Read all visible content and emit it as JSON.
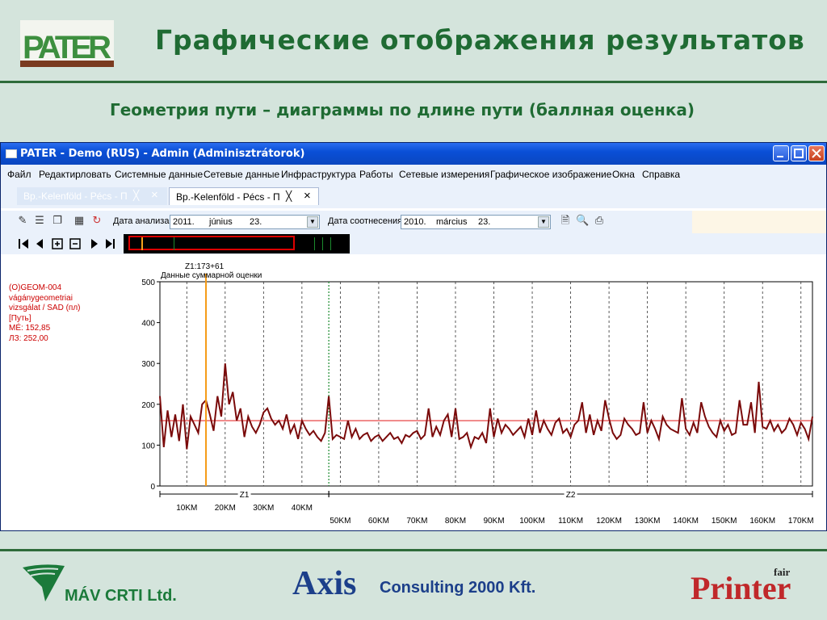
{
  "slide": {
    "logo_text": "PATER",
    "title": "Графические отображения результатов",
    "subtitle": "Геометрия пути – диаграммы по длине пути (баллная оценка)"
  },
  "window": {
    "title": "PATER - Demo (RUS) - Admin (Adminisztrátorok)",
    "menu": [
      "Файл",
      "Редактирловать",
      "Системные данные",
      "Сетевые данные",
      "Инфраструктура",
      "Работы",
      "Сетевые измерения",
      "Графическое изображение",
      "Окна",
      "Справка"
    ],
    "tabs": [
      {
        "label": "Bp.-Kelenföld - Pécs - П",
        "active": false
      },
      {
        "label": "Bp.-Kelenföld - Pécs - П",
        "active": true
      }
    ],
    "toolbar": {
      "analysis_date_label": "Дата анализа",
      "analysis_date": {
        "year": "2011.",
        "month": "június",
        "day": "23."
      },
      "compare_date_label": "Дата соотнесения",
      "compare_date": {
        "year": "2010.",
        "month": "március",
        "day": "23."
      }
    }
  },
  "legend": {
    "lines": [
      "(O)GEOM-004",
      "vágánygeometriai",
      "vizsgálat / SAD (пл)",
      "[Путь]",
      "MÉ: 152,85",
      "ЛЗ: 252,00"
    ]
  },
  "chart_data": {
    "type": "line",
    "title": "Данные суммарной оценки",
    "cursor_label": "Z1:173+61",
    "ylim": [
      0,
      500
    ],
    "yticks": [
      0,
      100,
      200,
      300,
      400,
      500
    ],
    "xlim": [
      3,
      173
    ],
    "x_ticks": [
      {
        "km": 10,
        "label": "10KM"
      },
      {
        "km": 20,
        "label": "20KM"
      },
      {
        "km": 30,
        "label": "30KM"
      },
      {
        "km": 40,
        "label": "40KM"
      },
      {
        "km": 50,
        "label": "50KM"
      },
      {
        "km": 60,
        "label": "60KM"
      },
      {
        "km": 70,
        "label": "70KM"
      },
      {
        "km": 80,
        "label": "80KM"
      },
      {
        "km": 90,
        "label": "90KM"
      },
      {
        "km": 100,
        "label": "100KM"
      },
      {
        "km": 110,
        "label": "110KM"
      },
      {
        "km": 120,
        "label": "120KM"
      },
      {
        "km": 130,
        "label": "130KM"
      },
      {
        "km": 140,
        "label": "140KM"
      },
      {
        "km": 150,
        "label": "150KM"
      },
      {
        "km": 160,
        "label": "160KM"
      },
      {
        "km": 170,
        "label": "170KM"
      }
    ],
    "zones": [
      {
        "label": "Z1",
        "from": 3,
        "to": 47
      },
      {
        "label": "Z2",
        "from": 47,
        "to": 173
      }
    ],
    "cursor_km": 15,
    "reference_value": 160,
    "series": [
      {
        "x": [
          3,
          4,
          5,
          6,
          7,
          8,
          9,
          10,
          11,
          12,
          13,
          14,
          15,
          16,
          17,
          18,
          19,
          20,
          21,
          22,
          23,
          24,
          25,
          26,
          27,
          28,
          29,
          30,
          31,
          32,
          33,
          34,
          35,
          36,
          37,
          38,
          39,
          40,
          41,
          42,
          43,
          44,
          45,
          46,
          47,
          48,
          49,
          50,
          51,
          52,
          53,
          54,
          55,
          56,
          57,
          58,
          59,
          60,
          61,
          62,
          63,
          64,
          65,
          66,
          67,
          68,
          69,
          70,
          71,
          72,
          73,
          74,
          75,
          76,
          77,
          78,
          79,
          80,
          81,
          82,
          83,
          84,
          85,
          86,
          87,
          88,
          89,
          90,
          91,
          92,
          93,
          94,
          95,
          96,
          97,
          98,
          99,
          100,
          101,
          102,
          103,
          104,
          105,
          106,
          107,
          108,
          109,
          110,
          111,
          112,
          113,
          114,
          115,
          116,
          117,
          118,
          119,
          120,
          121,
          122,
          123,
          124,
          125,
          126,
          127,
          128,
          129,
          130,
          131,
          132,
          133,
          134,
          135,
          136,
          137,
          138,
          139,
          140,
          141,
          142,
          143,
          144,
          145,
          146,
          147,
          148,
          149,
          150,
          151,
          152,
          153,
          154,
          155,
          156,
          157,
          158,
          159,
          160,
          161,
          162,
          163,
          164,
          165,
          166,
          167,
          168,
          169,
          170,
          171,
          172,
          173
        ],
        "values": [
          220,
          95,
          185,
          120,
          175,
          110,
          200,
          90,
          170,
          150,
          130,
          200,
          210,
          175,
          135,
          220,
          170,
          300,
          200,
          230,
          160,
          190,
          120,
          170,
          145,
          130,
          150,
          180,
          190,
          165,
          150,
          160,
          140,
          175,
          130,
          150,
          115,
          160,
          140,
          125,
          135,
          120,
          110,
          130,
          220,
          115,
          125,
          120,
          115,
          160,
          120,
          140,
          115,
          125,
          130,
          110,
          120,
          125,
          110,
          120,
          130,
          115,
          120,
          105,
          125,
          120,
          130,
          135,
          115,
          125,
          190,
          120,
          145,
          125,
          160,
          175,
          120,
          190,
          115,
          120,
          130,
          95,
          120,
          115,
          130,
          105,
          190,
          120,
          165,
          130,
          150,
          140,
          125,
          135,
          145,
          120,
          165,
          125,
          185,
          130,
          160,
          140,
          125,
          155,
          165,
          130,
          140,
          120,
          150,
          160,
          205,
          130,
          175,
          125,
          160,
          135,
          210,
          165,
          130,
          115,
          125,
          165,
          150,
          140,
          125,
          130,
          205,
          130,
          160,
          140,
          115,
          170,
          150,
          140,
          135,
          130,
          215,
          140,
          125,
          155,
          130,
          205,
          170,
          145,
          130,
          120,
          160,
          135,
          150,
          125,
          130,
          210,
          150,
          150,
          205,
          130,
          255,
          145,
          140,
          160,
          135,
          150,
          130,
          140,
          165,
          150,
          125,
          155,
          140,
          115,
          170
        ]
      }
    ]
  },
  "footer": {
    "mav": "MÁV CRTI Ltd.",
    "axis_logo": "Axis",
    "axis": "Consulting 2000 Kft.",
    "printer_logo": "Printer",
    "printer_fair": "fair"
  }
}
